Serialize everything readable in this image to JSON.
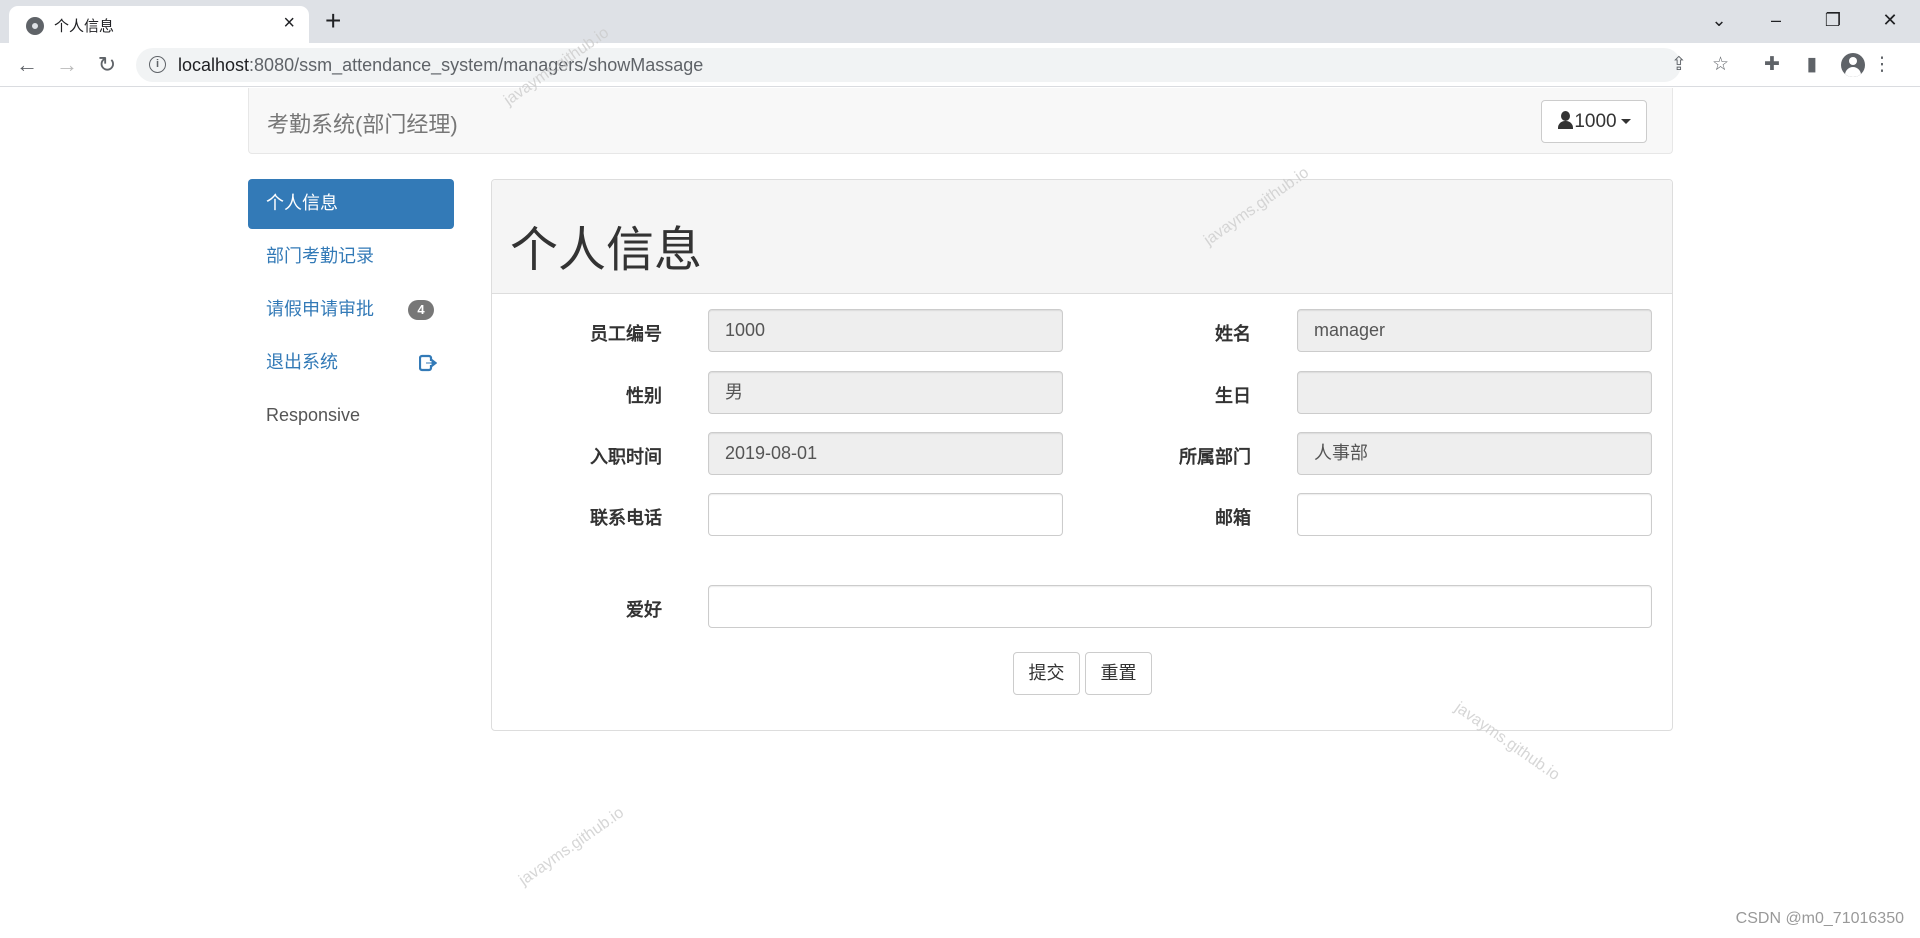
{
  "browser": {
    "tab_title": "个人信息",
    "url_host": "localhost",
    "url_rest": ":8080/ssm_attendance_system/managers/showMassage"
  },
  "navbar": {
    "brand": "考勤系统(部门经理)",
    "user_label": "1000"
  },
  "sidebar": {
    "items": [
      {
        "label": "个人信息",
        "active": true
      },
      {
        "label": "部门考勤记录"
      },
      {
        "label": "请假申请审批",
        "badge": "4"
      },
      {
        "label": "退出系统",
        "icon": "logout-icon"
      },
      {
        "label": "Responsive"
      }
    ]
  },
  "panel": {
    "title": "个人信息",
    "fields": {
      "employee_id": {
        "label": "员工编号",
        "value": "1000"
      },
      "name": {
        "label": "姓名",
        "value": "manager"
      },
      "gender": {
        "label": "性别",
        "value": "男"
      },
      "birthday": {
        "label": "生日",
        "value": ""
      },
      "hire_date": {
        "label": "入职时间",
        "value": "2019-08-01"
      },
      "department": {
        "label": "所属部门",
        "value": "人事部"
      },
      "phone": {
        "label": "联系电话",
        "value": ""
      },
      "email": {
        "label": "邮箱",
        "value": ""
      },
      "hobby": {
        "label": "爱好",
        "value": ""
      }
    },
    "submit_label": "提交",
    "reset_label": "重置"
  },
  "watermark": "javayms.github.io",
  "footer_mark": "CSDN @m0_71016350",
  "colors": {
    "primary": "#337ab7",
    "badge": "#777777",
    "readonly_bg": "#eeeeee"
  }
}
